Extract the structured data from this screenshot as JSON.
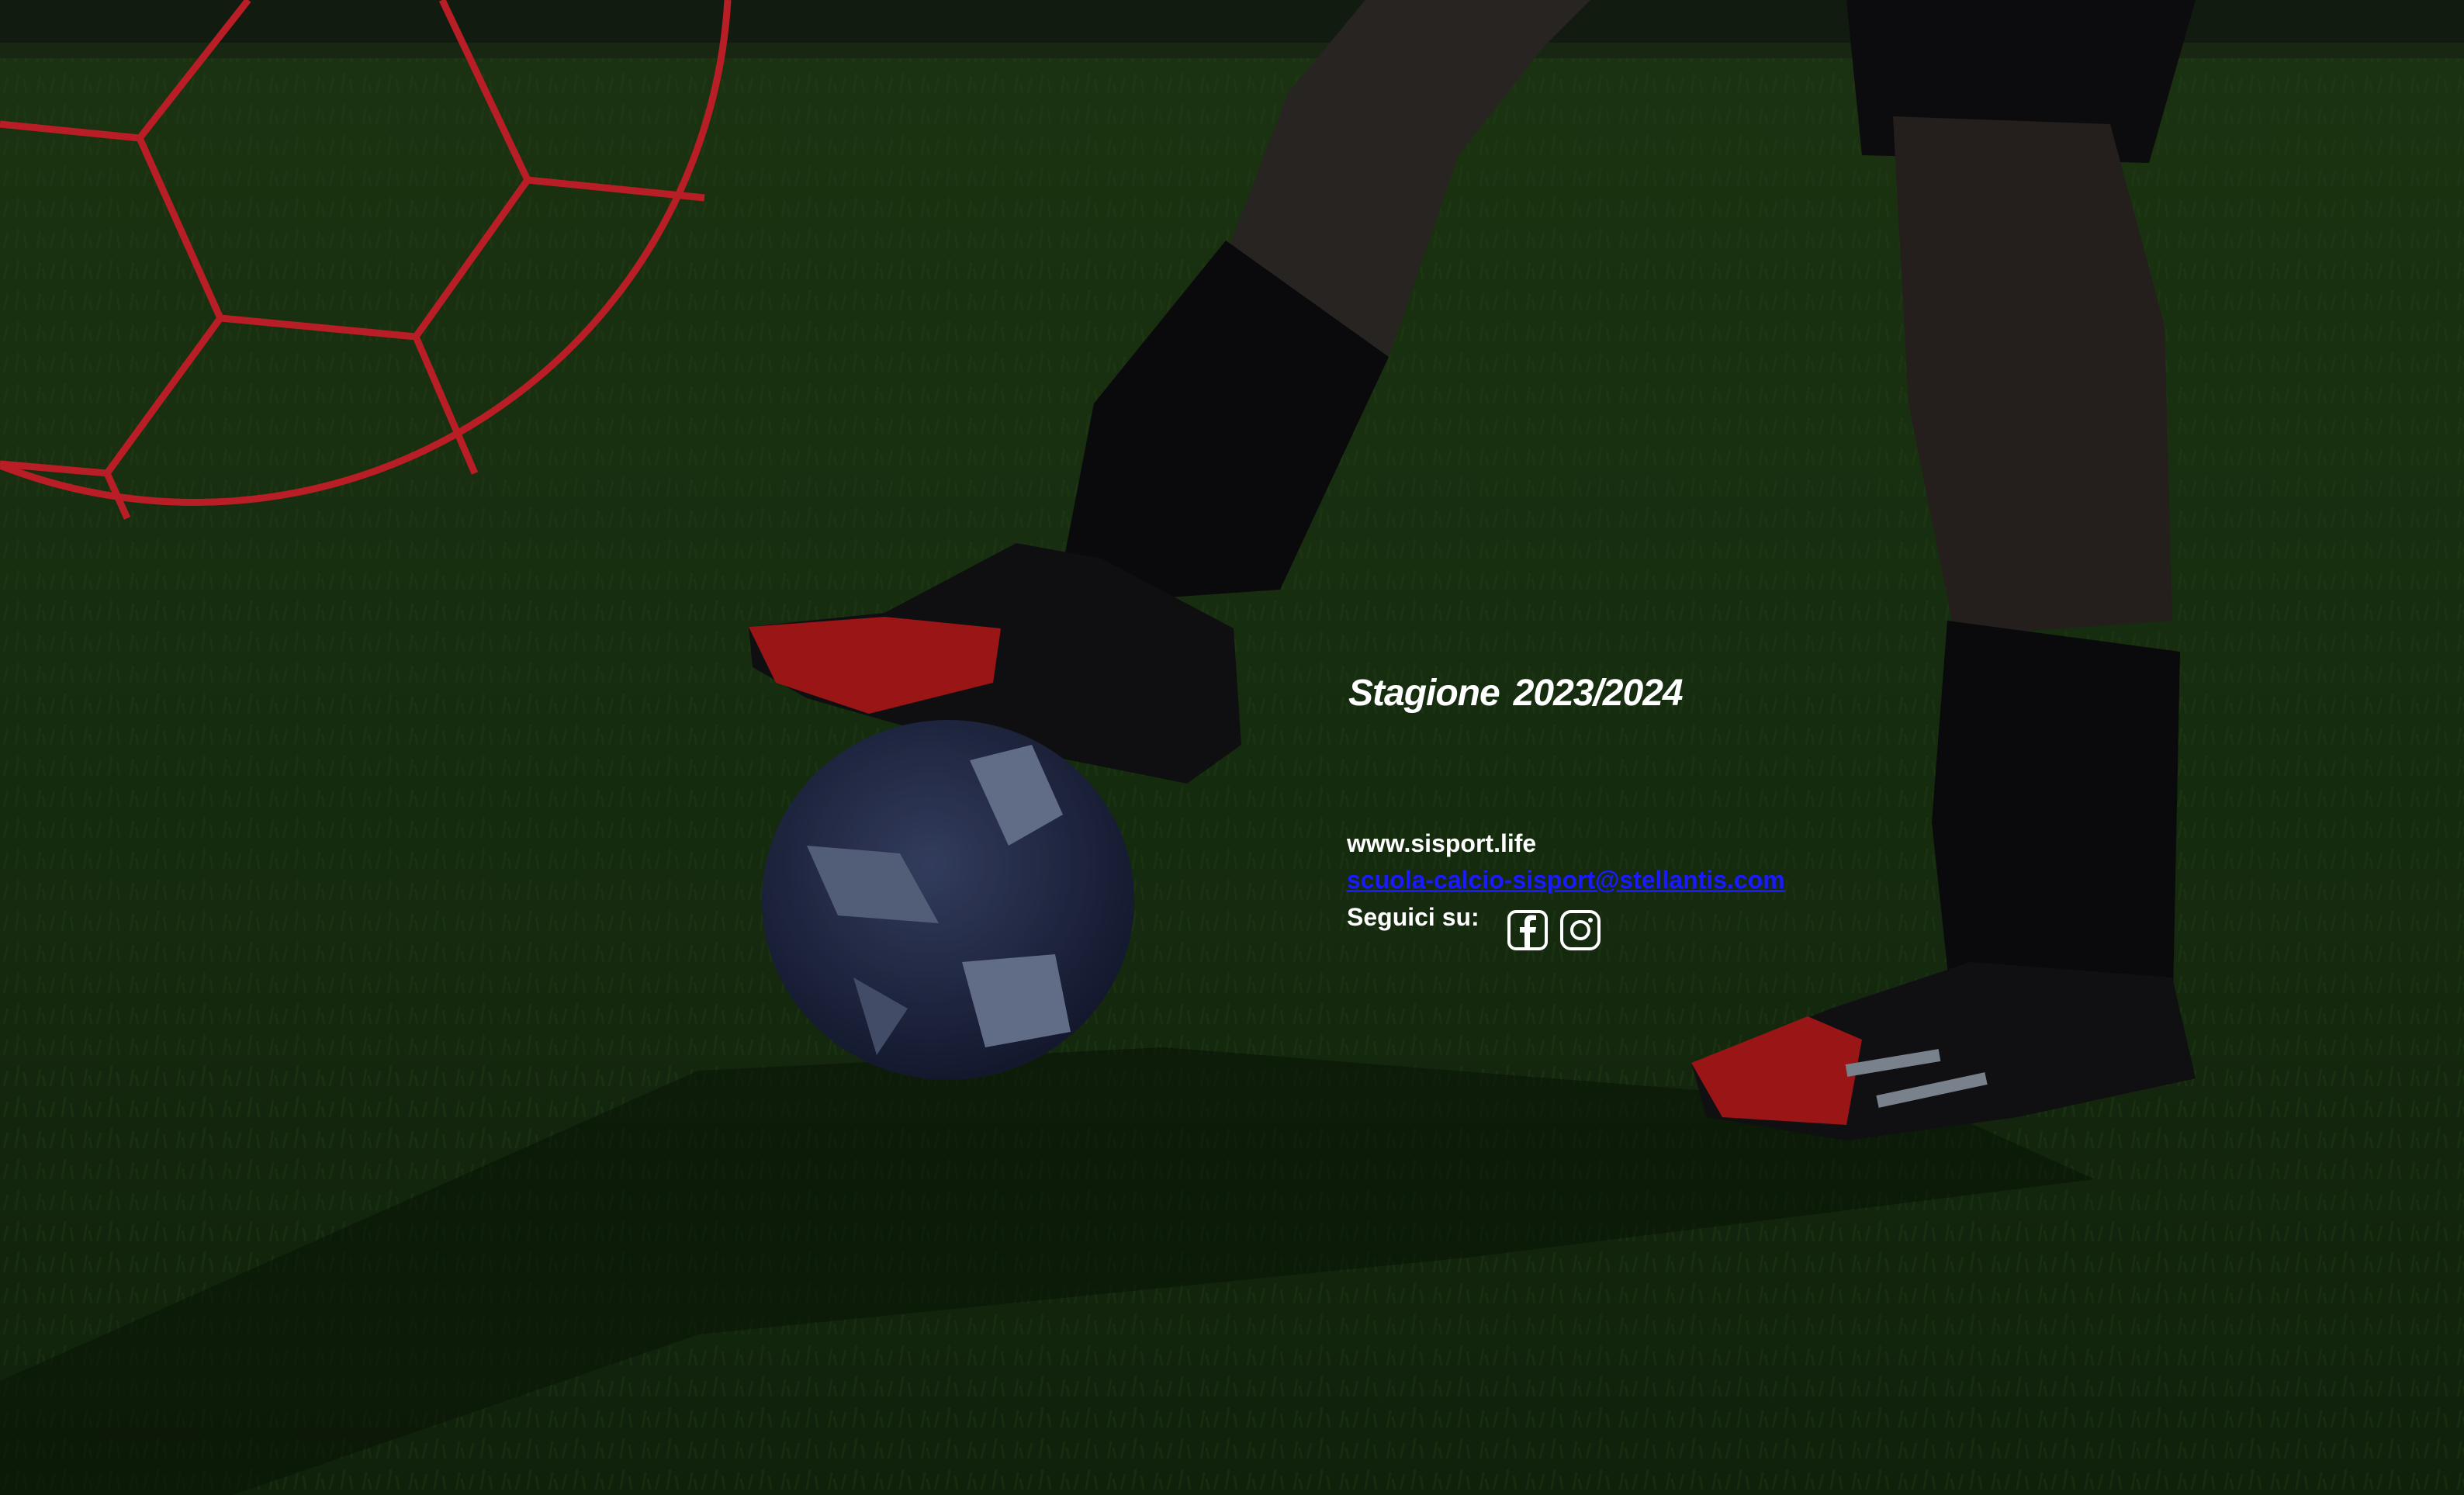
{
  "season": {
    "label": "Stagione",
    "year": "2023/2024"
  },
  "contacts": {
    "website": "www.sisport.life",
    "email": "scuola-calcio-sisport@stellantis.com",
    "follow_label": "Seguici su:"
  },
  "social": [
    {
      "icon": "facebook-icon"
    },
    {
      "icon": "instagram-icon"
    }
  ],
  "colors": {
    "ball_outline": "#d3232c",
    "text": "#ffffff",
    "link": "#1a1aff",
    "grass": "#1f3a14",
    "boot_red": "#b01818"
  }
}
